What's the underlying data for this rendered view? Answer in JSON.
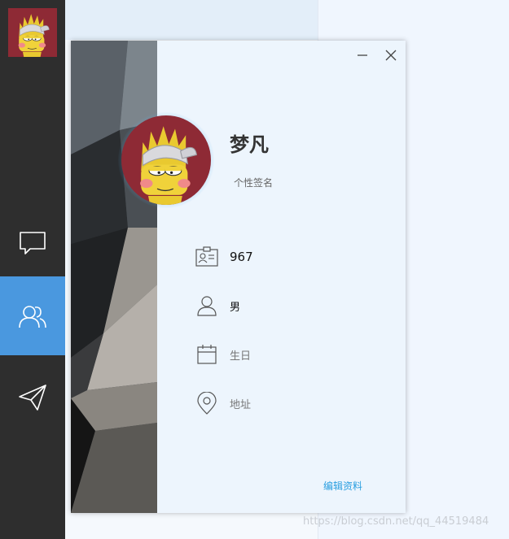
{
  "sidebar": {
    "avatar_icon": "cartoon-avatar-icon",
    "items": [
      {
        "icon": "chat-bubble-icon"
      },
      {
        "icon": "contacts-icon",
        "active": true
      },
      {
        "icon": "paper-plane-icon"
      }
    ]
  },
  "profile": {
    "name": "梦凡",
    "signature": "个性签名",
    "id_number": "967",
    "gender": "男",
    "birthday": "生日",
    "address": "地址",
    "edit_label": "编辑资料"
  },
  "window": {
    "minimize_icon": "minimize-icon",
    "close_icon": "close-icon"
  },
  "watermark": "https://blog.csdn.net/qq_44519484",
  "colors": {
    "sidebar": "#2e2e2e",
    "active_nav": "#4a98df",
    "link": "#2b9fe0",
    "card_bg": "#edf5fd"
  }
}
